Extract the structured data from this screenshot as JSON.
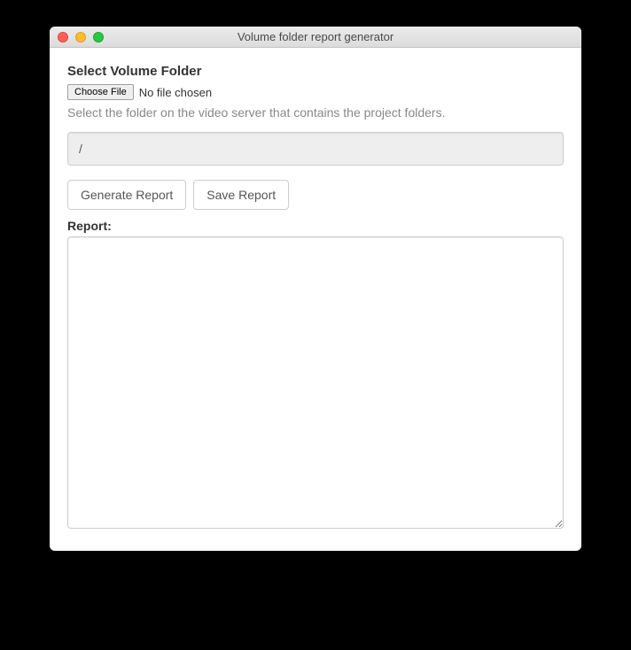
{
  "window": {
    "title": "Volume folder report generator"
  },
  "form": {
    "heading": "Select Volume Folder",
    "choose_file_label": "Choose File",
    "no_file_text": "No file chosen",
    "helper_text": "Select the folder on the video server that contains the project folders.",
    "path_value": "/"
  },
  "buttons": {
    "generate": "Generate Report",
    "save": "Save Report"
  },
  "report": {
    "label": "Report:",
    "content": ""
  }
}
